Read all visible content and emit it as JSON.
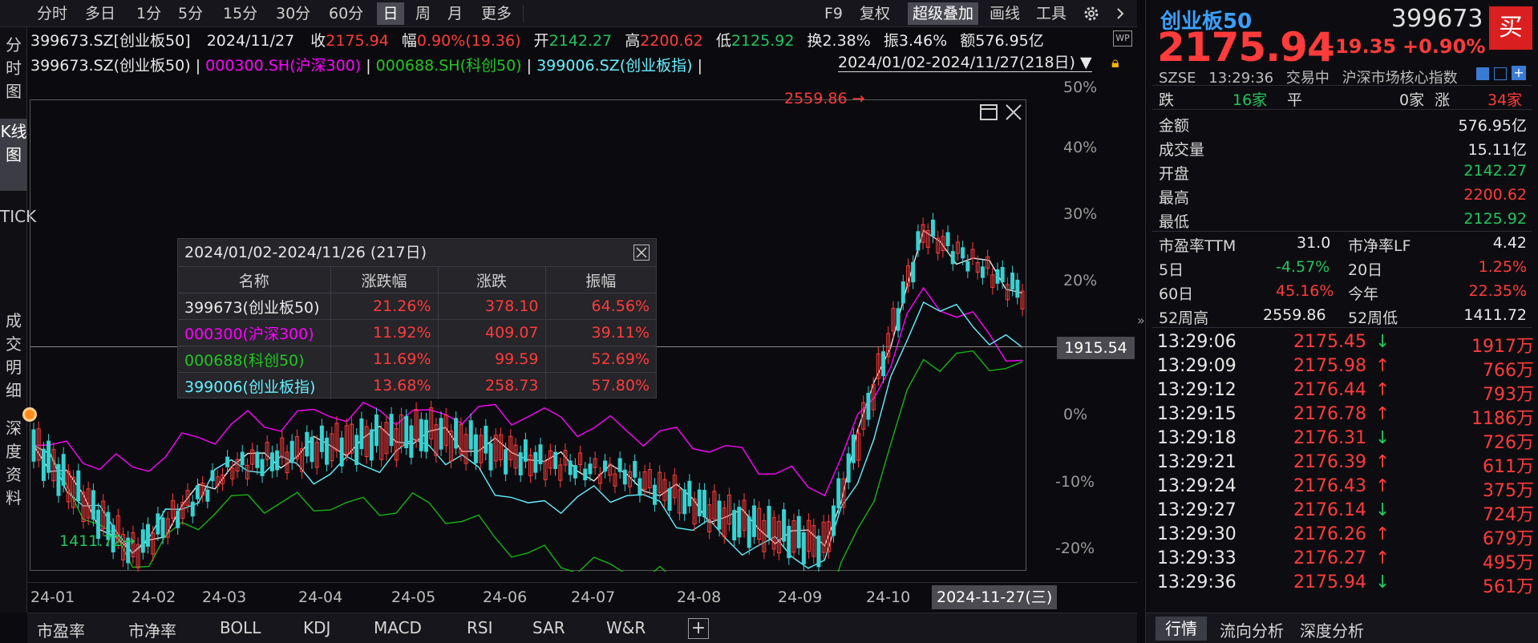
{
  "toolbar": {
    "items": [
      "分时",
      "多日",
      "1分",
      "5分",
      "15分",
      "30分",
      "60分",
      "日",
      "周",
      "月",
      "更多"
    ],
    "right_items": [
      "F9",
      "复权",
      "超级叠加",
      "画线",
      "工具"
    ]
  },
  "leftnav": [
    "分时图",
    "K线图",
    "TICK",
    "成交明细",
    "深度资料"
  ],
  "info_row1": {
    "code": "399673.SZ[创业板50]",
    "date": "2024/11/27",
    "close_label": "收",
    "close": "2175.94",
    "chg_label": "幅",
    "chg": "0.90%(19.36)",
    "open_label": "开",
    "open": "2142.27",
    "high_label": "高",
    "high": "2200.62",
    "low_label": "低",
    "low": "2125.92",
    "turnover": "换2.38%",
    "amplitude": "振3.46%",
    "amount": "额576.95亿"
  },
  "info_row2": {
    "s1": "399673.SZ(创业板50)",
    "s2": "000300.SH(沪深300)",
    "s3": "000688.SH(科创50)",
    "s4": "399006.SZ(创业板指)",
    "sep": "|",
    "range": "2024/01/02-2024/11/27(218日)"
  },
  "chart": {
    "max_label": "2559.86",
    "min_label": "1411.72",
    "crosshair_value": "1915.54",
    "y_ticks": [
      "50%",
      "40%",
      "30%",
      "20%",
      "0%",
      "-10%",
      "-20%"
    ],
    "x_ticks": [
      "24-01",
      "24-02",
      "24-03",
      "24-04",
      "24-05",
      "24-06",
      "24-07",
      "24-08",
      "24-09",
      "24-10"
    ],
    "x_cursor": "2024-11-27(三)",
    "colors": {
      "s1": "#e8e8e8",
      "s2": "#ff00ff",
      "s3": "#16b316",
      "s4": "#66f0ff",
      "up": "#ff3b3b",
      "down": "#36d2d2"
    }
  },
  "chart_data": {
    "type": "line",
    "title": "",
    "xlabel": "",
    "ylabel": "",
    "ylim": [
      -25,
      50
    ],
    "x": [
      "24-01",
      "24-02",
      "24-03",
      "24-04",
      "24-05",
      "24-06",
      "24-07",
      "24-08",
      "24-09",
      "24-10",
      "24-11"
    ],
    "series": [
      {
        "name": "399673.SZ(创业板50)",
        "values": [
          0,
          -15,
          -3,
          0,
          2,
          -2,
          -4,
          -10,
          -14,
          30,
          21.3
        ]
      },
      {
        "name": "000300.SH(沪深300)",
        "values": [
          0,
          -3,
          3,
          4,
          5,
          4,
          2,
          0,
          -7,
          22,
          11.9
        ]
      },
      {
        "name": "000688.SH(科创50)",
        "values": [
          0,
          -17,
          -7,
          -9,
          -8,
          -15,
          -18,
          -20,
          -24,
          12,
          11.7
        ]
      },
      {
        "name": "399006.SZ(创业板指)",
        "values": [
          0,
          -15,
          -2,
          -4,
          0,
          -8,
          -7,
          -13,
          -16,
          20,
          13.7
        ]
      }
    ]
  },
  "popup": {
    "title": "2024/01/02-2024/11/26 (217日)",
    "headers": [
      "名称",
      "涨跌幅",
      "涨跌",
      "振幅"
    ],
    "rows": [
      [
        "399673(创业板50)",
        "21.26%",
        "378.10",
        "64.56%"
      ],
      [
        "000300(沪深300)",
        "11.92%",
        "409.07",
        "39.11%"
      ],
      [
        "000688(科创50)",
        "11.69%",
        "99.59",
        "52.69%"
      ],
      [
        "399006(创业板指)",
        "13.68%",
        "258.73",
        "57.80%"
      ]
    ]
  },
  "bottom_tabs": [
    "市盈率",
    "市净率",
    "BOLL",
    "KDJ",
    "MACD",
    "RSI",
    "SAR",
    "W&R"
  ],
  "right": {
    "name": "创业板50",
    "code": "399673",
    "price": "2175.94",
    "chg": "+19.35",
    "pct": "+0.90%",
    "buy": "买",
    "exchange": "SZSE",
    "time": "13:29:36",
    "status": "交易中",
    "desc": "沪深市场核心指数",
    "breadth": {
      "down_label": "跌",
      "down": "16家",
      "flat_label": "平",
      "flat": "0家",
      "up_label": "涨",
      "up": "34家"
    },
    "stats": [
      [
        "金额",
        "576.95亿"
      ],
      [
        "成交量",
        "15.11亿"
      ],
      [
        "开盘",
        "2142.27"
      ],
      [
        "最高",
        "2200.62"
      ],
      [
        "最低",
        "2125.92"
      ]
    ],
    "pe_label": "市盈率TTM",
    "pe": "31.0",
    "pb_label": "市净率LF",
    "pb": "4.42",
    "perf": [
      [
        "5日",
        "-4.57%",
        "20日",
        "1.25%"
      ],
      [
        "60日",
        "45.16%",
        "今年",
        "22.35%"
      ],
      [
        "52周高",
        "2559.86",
        "52周低",
        "1411.72"
      ]
    ],
    "ticks": [
      [
        "13:29:06",
        "2175.45",
        "down",
        "1917万"
      ],
      [
        "13:29:09",
        "2175.98",
        "up",
        "766万"
      ],
      [
        "13:29:12",
        "2176.44",
        "up",
        "793万"
      ],
      [
        "13:29:15",
        "2176.78",
        "up",
        "1186万"
      ],
      [
        "13:29:18",
        "2176.31",
        "down",
        "726万"
      ],
      [
        "13:29:21",
        "2176.39",
        "up",
        "611万"
      ],
      [
        "13:29:24",
        "2176.43",
        "up",
        "375万"
      ],
      [
        "13:29:27",
        "2176.14",
        "down",
        "724万"
      ],
      [
        "13:29:30",
        "2176.26",
        "up",
        "679万"
      ],
      [
        "13:29:33",
        "2176.27",
        "up",
        "495万"
      ],
      [
        "13:29:36",
        "2175.94",
        "down",
        "561万"
      ]
    ],
    "tabs": [
      "行情",
      "流向分析",
      "深度分析"
    ]
  }
}
